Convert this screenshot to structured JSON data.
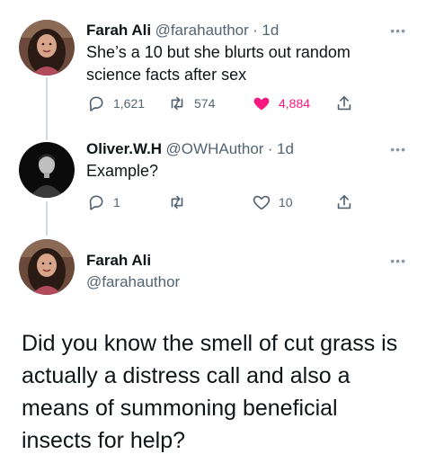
{
  "tweets": [
    {
      "name": "Farah Ali",
      "handle": "@farahauthor",
      "sep": "·",
      "time": "1d",
      "text": "She’s a 10 but she blurts out random science facts after sex",
      "actions": {
        "replies": "1,621",
        "retweets": "574",
        "likes": "4,884"
      },
      "liked": true
    },
    {
      "name": "Oliver.W.H",
      "handle": "@OWHAuthor",
      "sep": "·",
      "time": "1d",
      "text": "Example?",
      "actions": {
        "replies": "1",
        "retweets": "",
        "likes": "10"
      },
      "liked": false
    }
  ],
  "main_tweet": {
    "name": "Farah Ali",
    "handle": "@farahauthor",
    "text": "Did you know the smell of cut grass is actually a distress call and also a means of summoning beneficial insects for help?"
  },
  "more_label": "•••",
  "colors": {
    "like_active": "#f91880",
    "icon_gray": "#536471",
    "thread_line": "#cfd9de"
  }
}
